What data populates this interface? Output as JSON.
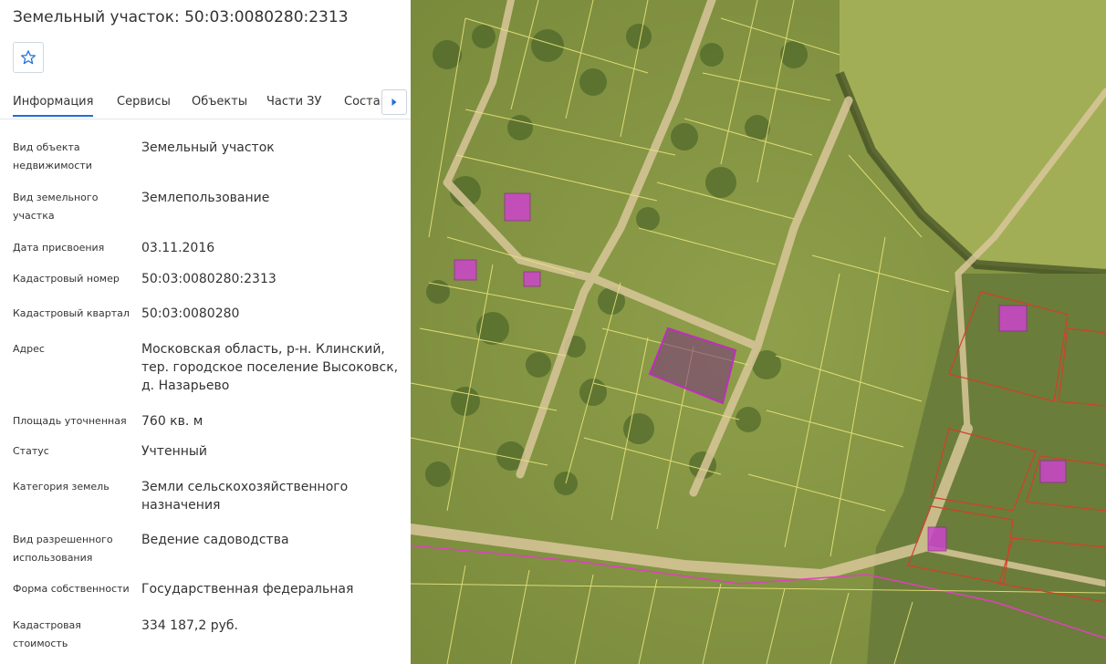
{
  "panel": {
    "title": "Земельный участок: 50:03:0080280:2313",
    "tabs": [
      {
        "label": "Информация",
        "active": true
      },
      {
        "label": "Сервисы"
      },
      {
        "label": "Объекты"
      },
      {
        "label": "Части ЗУ"
      },
      {
        "label": "Состав"
      }
    ],
    "fields": [
      {
        "label": "Вид объекта недвижимости",
        "value": "Земельный участок"
      },
      {
        "label": "Вид земельного участка",
        "value": "Землепользование"
      },
      {
        "label": "Дата присвоения",
        "value": "03.11.2016"
      },
      {
        "label": "Кадастровый номер",
        "value": "50:03:0080280:2313"
      },
      {
        "label": "Кадастровый квартал",
        "value": "50:03:0080280"
      },
      {
        "label": "Адрес",
        "value": "Московская область, р-н. Клинский, тер. городское поселение Высоковск, д. Назарьево"
      },
      {
        "label": "Площадь уточненная",
        "value": "760 кв. м"
      },
      {
        "label": "Статус",
        "value": "Учтенный"
      },
      {
        "label": "Категория земель",
        "value": "Земли сельскохозяйственного назначения"
      },
      {
        "label": "Вид разрешенного использования",
        "value": "Ведение садоводства"
      },
      {
        "label": "Форма собственности",
        "value": "Государственная федеральная"
      },
      {
        "label": "Кадастровая стоимость",
        "value": "334 187,2 руб."
      }
    ]
  },
  "icons": {
    "favorite": "star-outline-icon",
    "tabs_next": "caret-right-icon"
  },
  "colors": {
    "accent": "#1f6fd6",
    "parcel_border": "#e8e37a",
    "building_fill": "#cc44cc",
    "selected_parcel": "#c02cc0",
    "neighbor_border": "#d2402a",
    "map_field": "#8b9a45"
  }
}
